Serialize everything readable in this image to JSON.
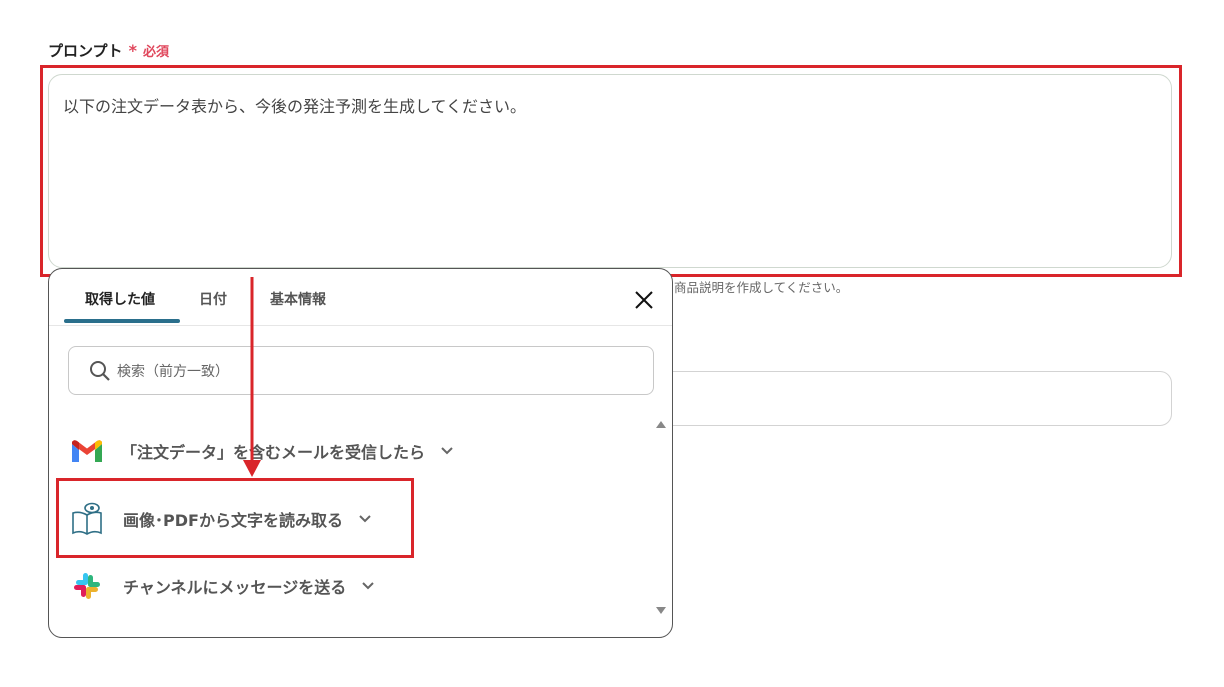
{
  "field": {
    "label": "プロンプト",
    "required_star": "*",
    "required_text": "必須"
  },
  "prompt": {
    "value": "以下の注文データ表から、今後の発注予測を生成してください。"
  },
  "helper": {
    "text": "商品説明を作成してください。"
  },
  "popover": {
    "tabs": [
      {
        "label": "取得した値",
        "active": true
      },
      {
        "label": "日付",
        "active": false
      },
      {
        "label": "基本情報",
        "active": false
      }
    ],
    "search": {
      "placeholder": "検索（前方一致）"
    },
    "items": [
      {
        "label": "「注文データ」を含むメールを受信したら",
        "icon": "gmail-icon"
      },
      {
        "label": "画像･PDFから文字を読み取る",
        "icon": "ocr-book-icon"
      },
      {
        "label": "チャンネルにメッセージを送る",
        "icon": "slack-icon"
      }
    ]
  },
  "colors": {
    "highlight_red": "#d9252a",
    "required_red": "#e0475c",
    "tab_underline": "#2a6f8c"
  }
}
